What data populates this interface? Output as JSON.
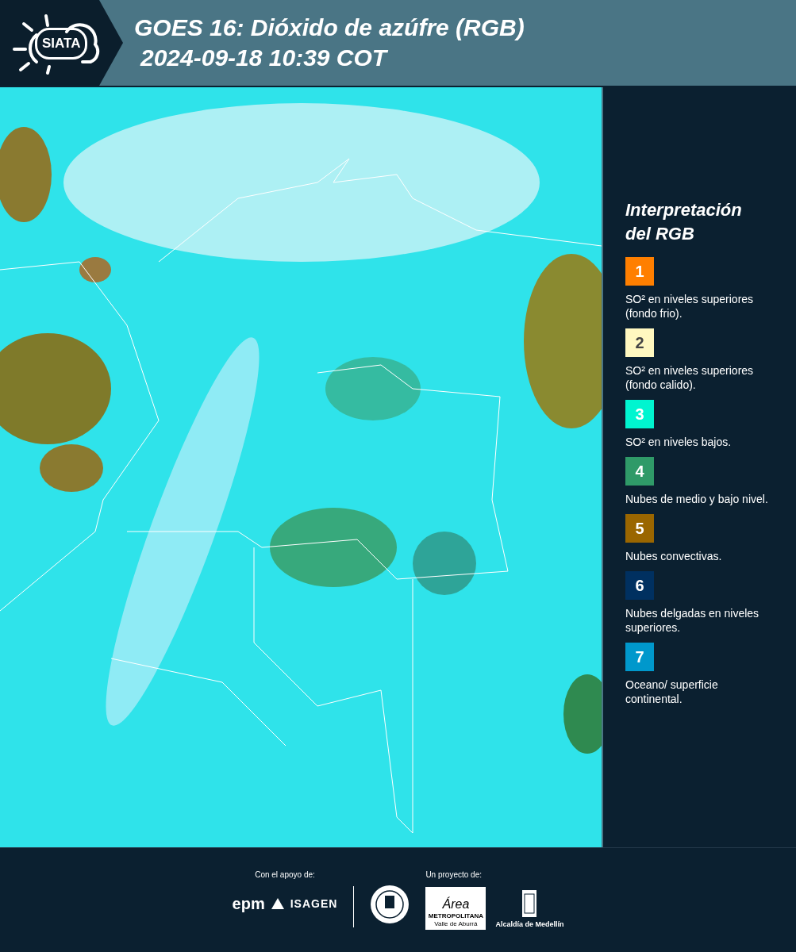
{
  "header": {
    "logo_text": "SIATA",
    "title_line_1": "GOES 16: Dióxido de azúfre (RGB)",
    "title_line_2": "2024-09-18 10:39 COT"
  },
  "legend": {
    "title": "Interpretación del RGB",
    "items": [
      {
        "number": "1",
        "color": "#ff7f00",
        "text": "SO² en niveles superiores (fondo frio)."
      },
      {
        "number": "2",
        "color": "#fff8c0",
        "text": "SO² en niveles superiores (fondo calido)."
      },
      {
        "number": "3",
        "color": "#00f5d0",
        "text": "SO² en niveles bajos."
      },
      {
        "number": "4",
        "color": "#2f9a68",
        "text": "Nubes de medio y bajo nivel."
      },
      {
        "number": "5",
        "color": "#9a6600",
        "text": "Nubes convectivas."
      },
      {
        "number": "6",
        "color": "#003060",
        "text": "Nubes delgadas en niveles superiores."
      },
      {
        "number": "7",
        "color": "#0098cc",
        "text": "Oceano/ superficie continental."
      }
    ]
  },
  "footer": {
    "support_label": "Con el apoyo de:",
    "support_logos": [
      "epm",
      "ISAGEN"
    ],
    "project_label": "Un proyecto de:",
    "area_logo": {
      "script": "Área",
      "line_1": "METROPOLITANA",
      "line_2": "Valle de Aburrá"
    },
    "alcaldia_label": "Alcaldía de Medellín"
  }
}
